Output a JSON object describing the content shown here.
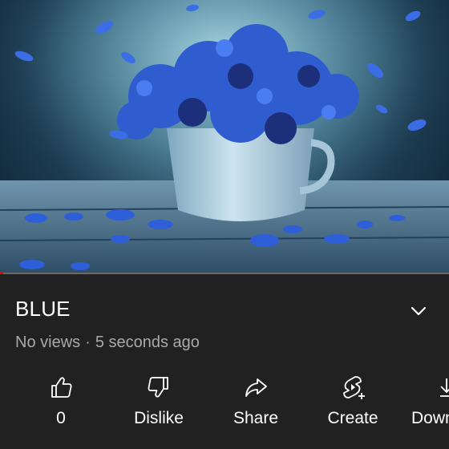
{
  "video": {
    "progress_fraction": 0.005
  },
  "title": "BLUE",
  "meta": {
    "views": "No views",
    "separator": "·",
    "time": "5 seconds ago"
  },
  "actions": [
    {
      "label": "0",
      "icon": "thumb-up-icon"
    },
    {
      "label": "Dislike",
      "icon": "thumb-down-icon"
    },
    {
      "label": "Share",
      "icon": "share-icon"
    },
    {
      "label": "Create",
      "icon": "create-icon"
    },
    {
      "label": "Down",
      "icon": "download-icon"
    }
  ],
  "colors": {
    "background": "#212121",
    "progress": "#ff0000",
    "meta_text": "#aaaaaa"
  }
}
